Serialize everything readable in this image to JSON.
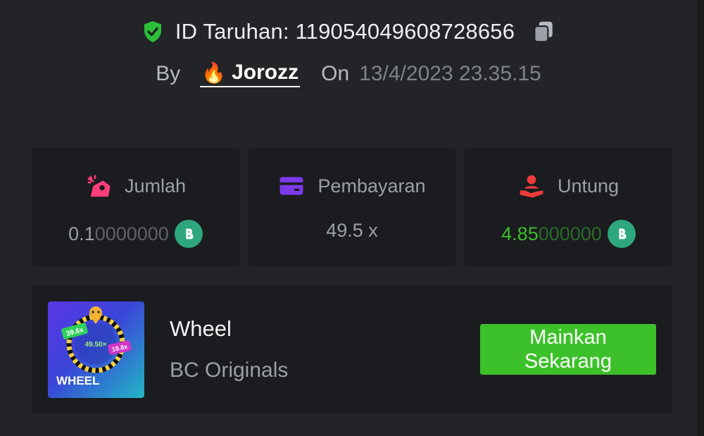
{
  "bet": {
    "id_label": "ID Taruhan: 119054049608728656",
    "by_label": "By",
    "username": "Jorozz",
    "on_label": "On",
    "date": "13/4/2023 23.35.15"
  },
  "stats": {
    "amount": {
      "label": "Jumlah",
      "value_main": "0.1",
      "value_dim": "0000000"
    },
    "payout": {
      "label": "Pembayaran",
      "value": "49.5 x"
    },
    "profit": {
      "label": "Untung",
      "value_main": "4.85",
      "value_dim": "000000"
    }
  },
  "game": {
    "thumb_title": "WHEEL",
    "thumb_mult_center": "49.50×",
    "thumb_mult_left": "39.6x",
    "thumb_mult_right": "19.8x",
    "name": "Wheel",
    "provider": "BC Originals",
    "play_label": "Mainkan Sekarang"
  },
  "colors": {
    "accent_green": "#3cc12a",
    "profit_green": "#3dbf2c",
    "coin": "#2ea77e",
    "amount_icon": "#ff3d7a",
    "payout_icon": "#7c3aed",
    "profit_icon": "#ef3b3b"
  }
}
